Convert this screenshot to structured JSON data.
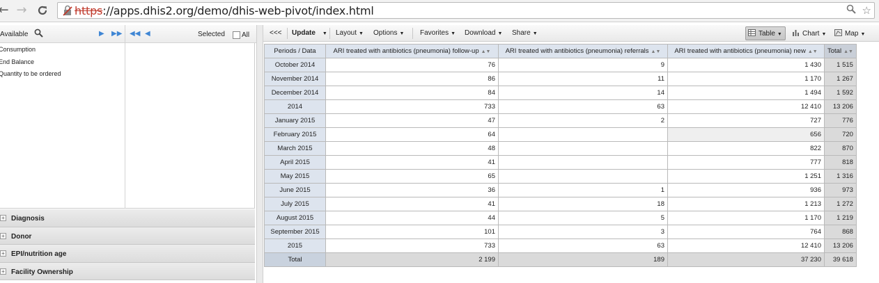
{
  "browser": {
    "url_scheme": "https",
    "url_rest": "://apps.dhis2.org/demo/dhis-web-pivot/index.html",
    "nav_back": "←",
    "nav_forward": "→",
    "nav_reload": "C",
    "zoom_icon": "🔍",
    "star_icon": "☆"
  },
  "left_panel": {
    "available_label": "Available",
    "selected_label": "Selected",
    "all_label": "All",
    "available_items": [
      "Consumption",
      "End Balance",
      "Quantity to be ordered"
    ],
    "dimensions": [
      "Diagnosis",
      "Donor",
      "EPI/nutrition age",
      "Facility Ownership"
    ]
  },
  "toolbar": {
    "collapse": "<<<",
    "update": "Update",
    "layout": "Layout",
    "options": "Options",
    "favorites": "Favorites",
    "download": "Download",
    "share": "Share",
    "table": "Table",
    "chart": "Chart",
    "map": "Map"
  },
  "pivot": {
    "headers": [
      "Periods / Data",
      "ARI treated with antibiotics (pneumonia) follow-up",
      "ARI treated with antibiotics (pneumonia) referrals",
      "ARI treated with antibiotics (pneumonia) new",
      "Total"
    ],
    "rows": [
      {
        "period": "October 2014",
        "followup": "76",
        "referrals": "9",
        "new": "1 430",
        "total": "1 515"
      },
      {
        "period": "November 2014",
        "followup": "86",
        "referrals": "11",
        "new": "1 170",
        "total": "1 267"
      },
      {
        "period": "December 2014",
        "followup": "84",
        "referrals": "14",
        "new": "1 494",
        "total": "1 592"
      },
      {
        "period": "2014",
        "followup": "733",
        "referrals": "63",
        "new": "12 410",
        "total": "13 206"
      },
      {
        "period": "January 2015",
        "followup": "47",
        "referrals": "2",
        "new": "727",
        "total": "776"
      },
      {
        "period": "February 2015",
        "followup": "64",
        "referrals": "",
        "new": "656",
        "total": "720"
      },
      {
        "period": "March 2015",
        "followup": "48",
        "referrals": "",
        "new": "822",
        "total": "870"
      },
      {
        "period": "April 2015",
        "followup": "41",
        "referrals": "",
        "new": "777",
        "total": "818"
      },
      {
        "period": "May 2015",
        "followup": "65",
        "referrals": "",
        "new": "1 251",
        "total": "1 316"
      },
      {
        "period": "June 2015",
        "followup": "36",
        "referrals": "1",
        "new": "936",
        "total": "973"
      },
      {
        "period": "July 2015",
        "followup": "41",
        "referrals": "18",
        "new": "1 213",
        "total": "1 272"
      },
      {
        "period": "August 2015",
        "followup": "44",
        "referrals": "5",
        "new": "1 170",
        "total": "1 219"
      },
      {
        "period": "September 2015",
        "followup": "101",
        "referrals": "3",
        "new": "764",
        "total": "868"
      },
      {
        "period": "2015",
        "followup": "733",
        "referrals": "63",
        "new": "12 410",
        "total": "13 206"
      }
    ],
    "total_row": {
      "period": "Total",
      "followup": "2 199",
      "referrals": "189",
      "new": "37 230",
      "total": "39 618"
    }
  }
}
